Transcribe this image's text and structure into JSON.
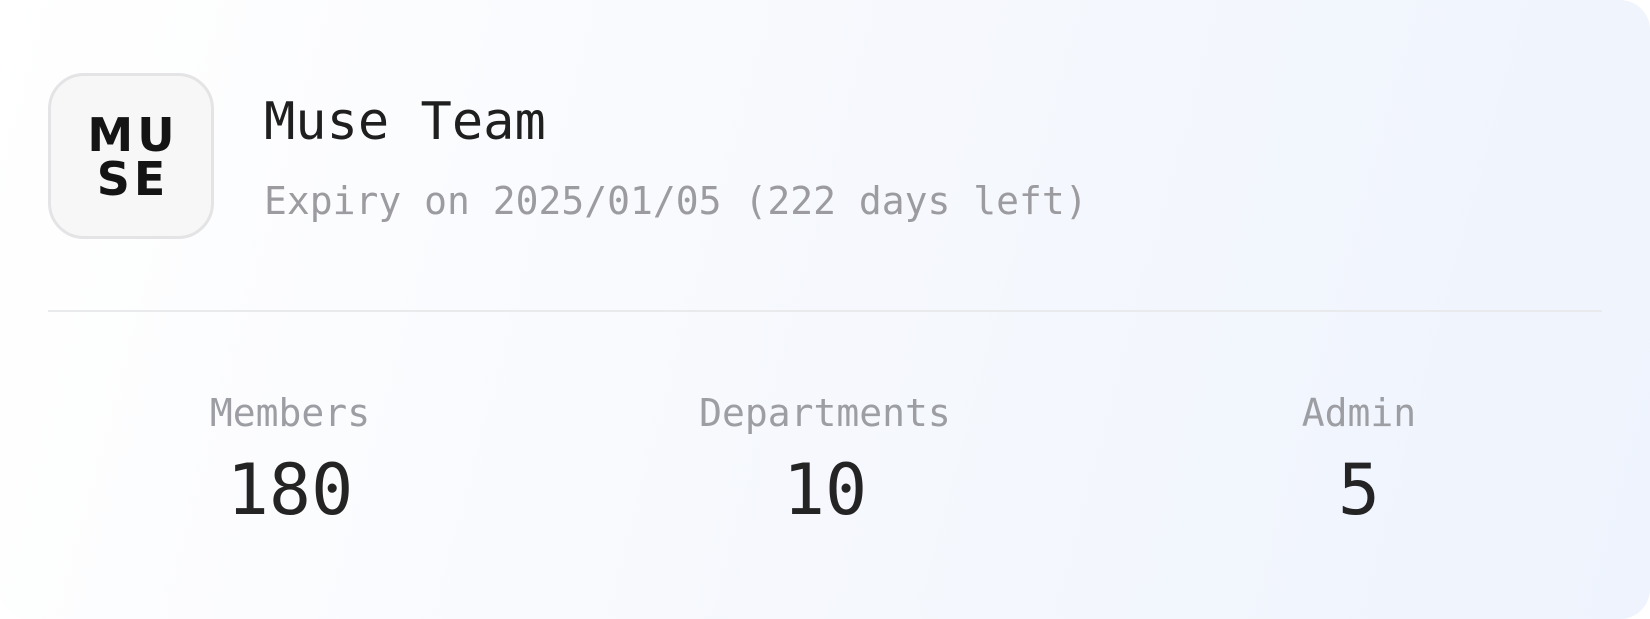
{
  "team": {
    "logo_text": [
      "MU",
      "SE"
    ],
    "name": "Muse Team",
    "expiry": "Expiry on 2025/01/05 (222 days left)"
  },
  "stats": [
    {
      "label": "Members",
      "value": "180"
    },
    {
      "label": "Departments",
      "value": "10"
    },
    {
      "label": "Admin",
      "value": "5"
    }
  ],
  "colors": {
    "card_gradient_start": "#ffffff",
    "card_gradient_end": "#eef3fd",
    "title": "#1f1f1f",
    "muted_text": "#9c9ca0",
    "value_text": "#242424",
    "divider": "#e9eaec",
    "logo_background": "#f7f7f7",
    "logo_border": "#e4e4e6"
  }
}
